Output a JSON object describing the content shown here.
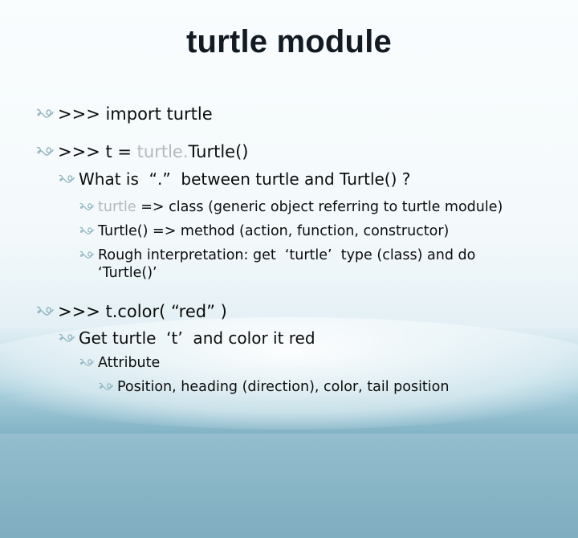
{
  "slide": {
    "title": "turtle module",
    "bullets": [
      {
        "prefix": ">>> import turtle"
      },
      {
        "prefix": ">>> t = ",
        "muted": "turtle.",
        "suffix": "Turtle()"
      },
      {
        "text": "What is  “.”  between turtle and Turtle() ?"
      },
      {
        "muted": "turtle",
        "suffix": " => class (generic object referring to turtle module)"
      },
      {
        "text": "Turtle() => method (action, function, constructor)"
      },
      {
        "text": "Rough interpretation: get  ‘turtle’  type (class) and do",
        "continuation": "‘Turtle()’"
      },
      {
        "prefix": ">>> t.color( “red” )"
      },
      {
        "text": "Get turtle  ‘t’  and color it red"
      },
      {
        "text": "Attribute"
      },
      {
        "text": "Position, heading (direction), color, tail position"
      }
    ]
  },
  "colors": {
    "bullet": "#8fb3bf",
    "muted_text": "#b4b8bc",
    "title": "#121a24"
  },
  "icons": {
    "bullet": "scroll-bullet-icon"
  }
}
